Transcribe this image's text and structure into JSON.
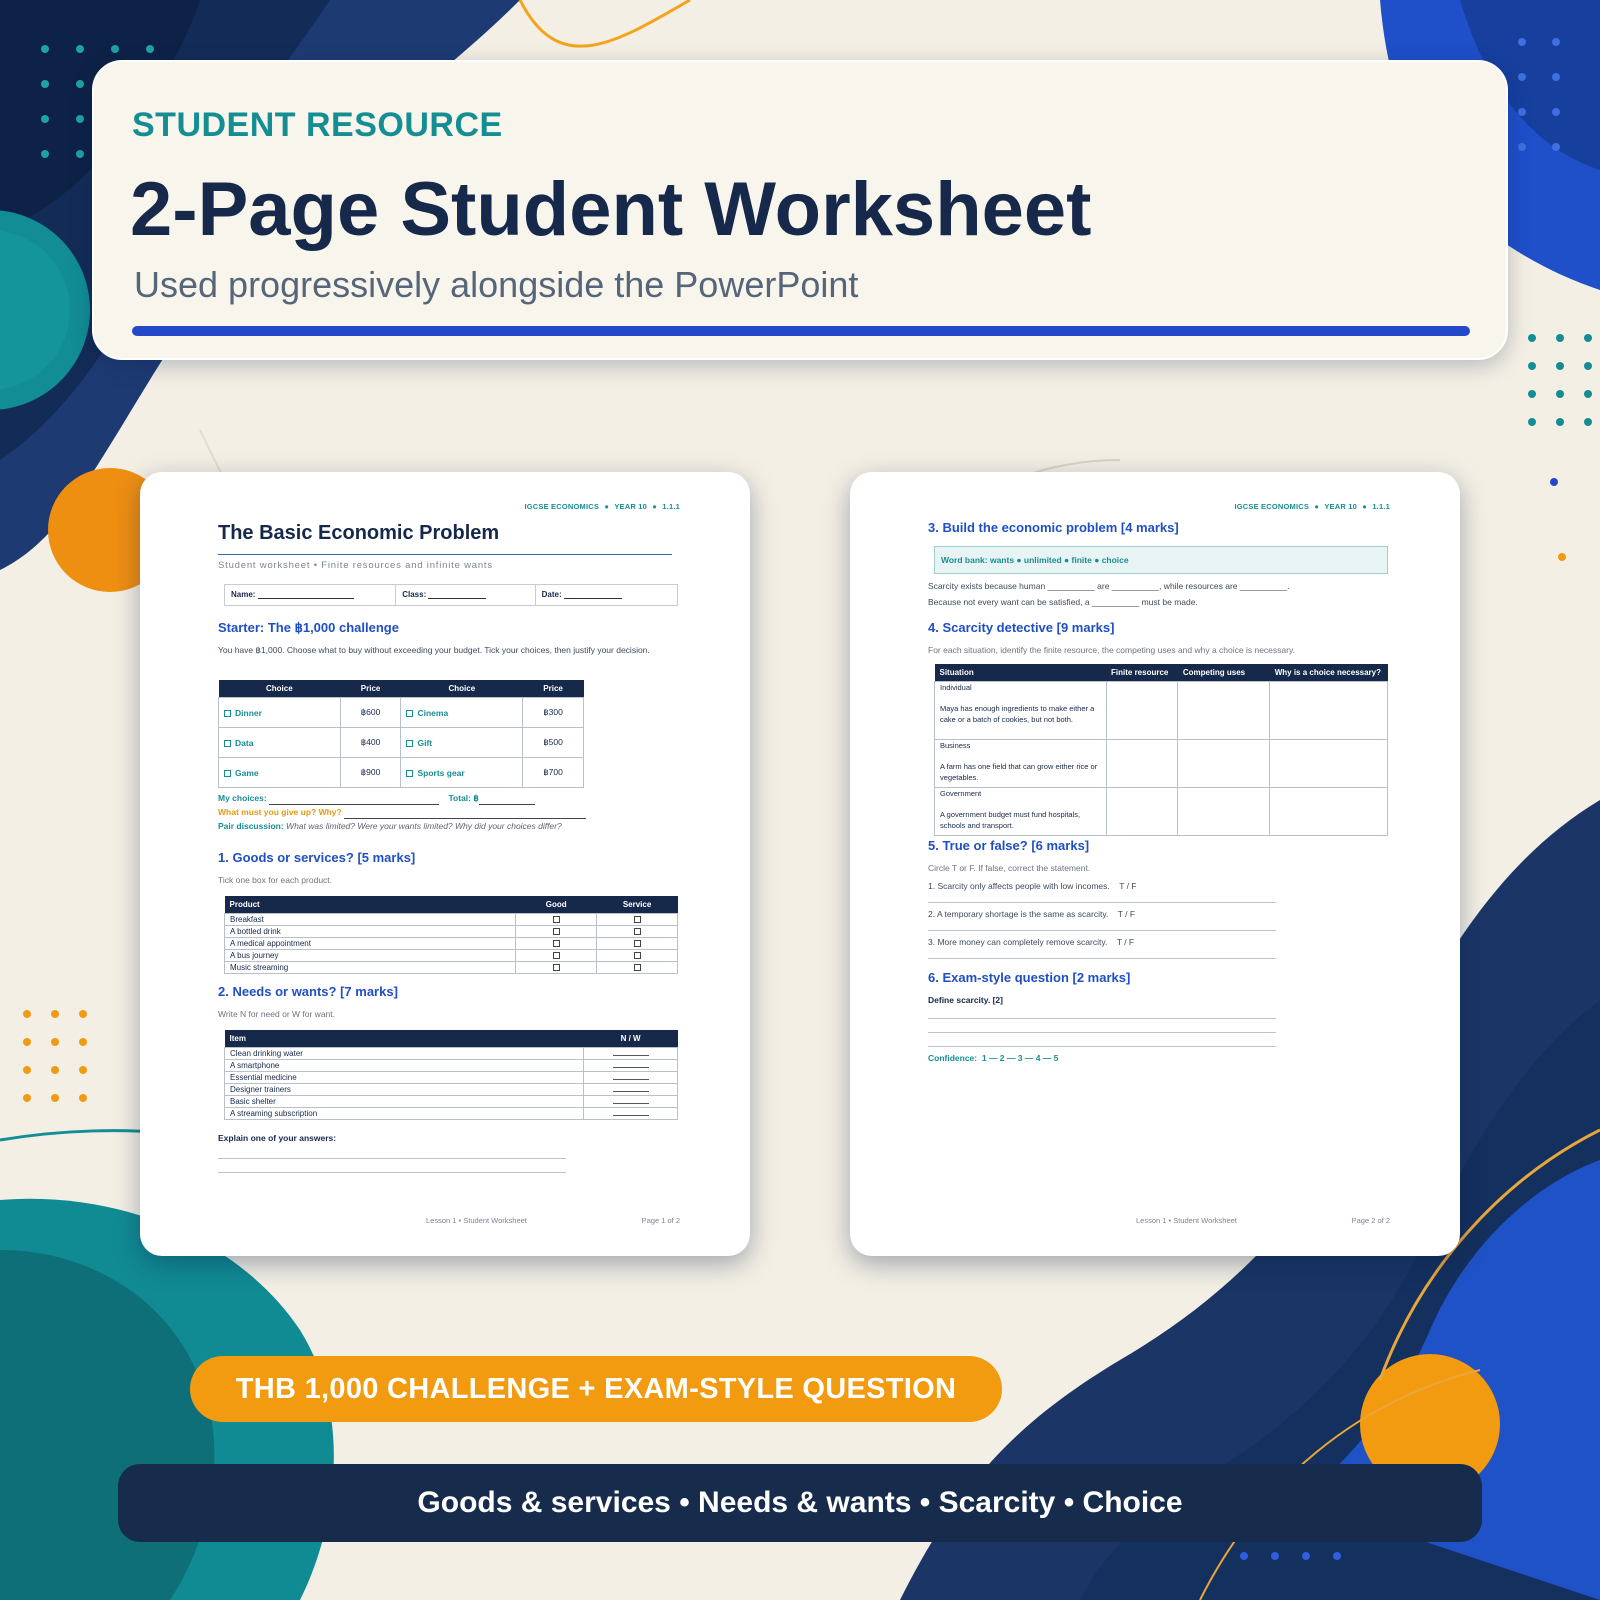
{
  "header": {
    "eyebrow": "STUDENT RESOURCE",
    "title": "2-Page Student Worksheet",
    "subtitle": "Used progressively alongside the PowerPoint"
  },
  "colors": {
    "navy": "#16294a",
    "teal": "#158e93",
    "blue": "#2349c9",
    "orange": "#f29a10",
    "cream": "#f3efe4"
  },
  "running_head": {
    "course": "IGCSE ECONOMICS",
    "year": "YEAR 10",
    "code": "1.1.1",
    "dot": "●"
  },
  "page1": {
    "title": "The Basic Economic Problem",
    "subtitle": "Student worksheet • Finite resources and infinite wants",
    "name_label": "Name:",
    "class_label": "Class:",
    "date_label": "Date:",
    "starter_heading": "Starter: The ฿1,000 challenge",
    "starter_text": "You have ฿1,000. Choose what to buy without exceeding your budget. Tick your choices, then justify your decision.",
    "choice_headers": [
      "Choice",
      "Price",
      "Choice",
      "Price"
    ],
    "choices": [
      {
        "a": "Dinner",
        "ap": "฿600",
        "b": "Cinema",
        "bp": "฿300"
      },
      {
        "a": "Data",
        "ap": "฿400",
        "b": "Gift",
        "bp": "฿500"
      },
      {
        "a": "Game",
        "ap": "฿900",
        "b": "Sports gear",
        "bp": "฿700"
      }
    ],
    "my_choices_label": "My choices:",
    "total_label": "Total: ฿",
    "give_up_label": "What must you give up? Why?",
    "pair_label": "Pair discussion:",
    "pair_text": "What was limited? Were your wants limited? Why did your choices differ?",
    "q1_heading": "1. Goods or services?  [5 marks]",
    "q1_instruction": "Tick one box for each product.",
    "q1_headers": [
      "Product",
      "Good",
      "Service"
    ],
    "q1_rows": [
      "Breakfast",
      "A bottled drink",
      "A medical appointment",
      "A bus journey",
      "Music streaming"
    ],
    "q2_heading": "2. Needs or wants?  [7 marks]",
    "q2_instruction": "Write N for need or W for want.",
    "q2_headers": [
      "Item",
      "N / W"
    ],
    "q2_rows": [
      "Clean drinking water",
      "A smartphone",
      "Essential medicine",
      "Designer trainers",
      "Basic shelter",
      "A streaming subscription"
    ],
    "explain_label": "Explain one of your answers:",
    "footer_center": "Lesson 1 • Student Worksheet",
    "footer_page": "Page 1 of 2"
  },
  "page2": {
    "q3_heading": "3. Build the economic problem  [4 marks]",
    "word_bank": "Word bank:  wants  ●  unlimited  ●  finite  ●  choice",
    "q3_line1": "Scarcity exists because human __________ are __________, while resources are __________.",
    "q3_line2": "Because not every want can be satisfied, a __________ must be made.",
    "q4_heading": "4. Scarcity detective  [9 marks]",
    "q4_instruction": "For each situation, identify the finite resource, the competing uses and why a choice is necessary.",
    "q4_headers": [
      "Situation",
      "Finite resource",
      "Competing uses",
      "Why is a choice necessary?"
    ],
    "q4_rows": [
      {
        "type": "Individual",
        "text": "Maya has enough ingredients to make either a cake or a batch of cookies, but not both."
      },
      {
        "type": "Business",
        "text": "A farm has one field that can grow either rice or vegetables."
      },
      {
        "type": "Government",
        "text": "A government budget must fund hospitals, schools and transport."
      }
    ],
    "q5_heading": "5. True or false?  [6 marks]",
    "q5_instruction": "Circle T or F. If false, correct the statement.",
    "q5_items": [
      "1.  Scarcity only affects people with low incomes.",
      "2.  A temporary shortage is the same as scarcity.",
      "3.  More money can completely remove scarcity."
    ],
    "tf_label": "T  /  F",
    "q6_heading": "6. Exam-style question  [2 marks]",
    "q6_prompt": "Define scarcity. [2]",
    "confidence_label": "Confidence:",
    "confidence_scale": "1  —  2  —  3  —  4  —  5",
    "footer_center": "Lesson 1 • Student Worksheet",
    "footer_page": "Page 2 of 2"
  },
  "badge": "THB 1,000 CHALLENGE + EXAM-STYLE QUESTION",
  "topics_bar": "Goods & services • Needs & wants • Scarcity • Choice"
}
